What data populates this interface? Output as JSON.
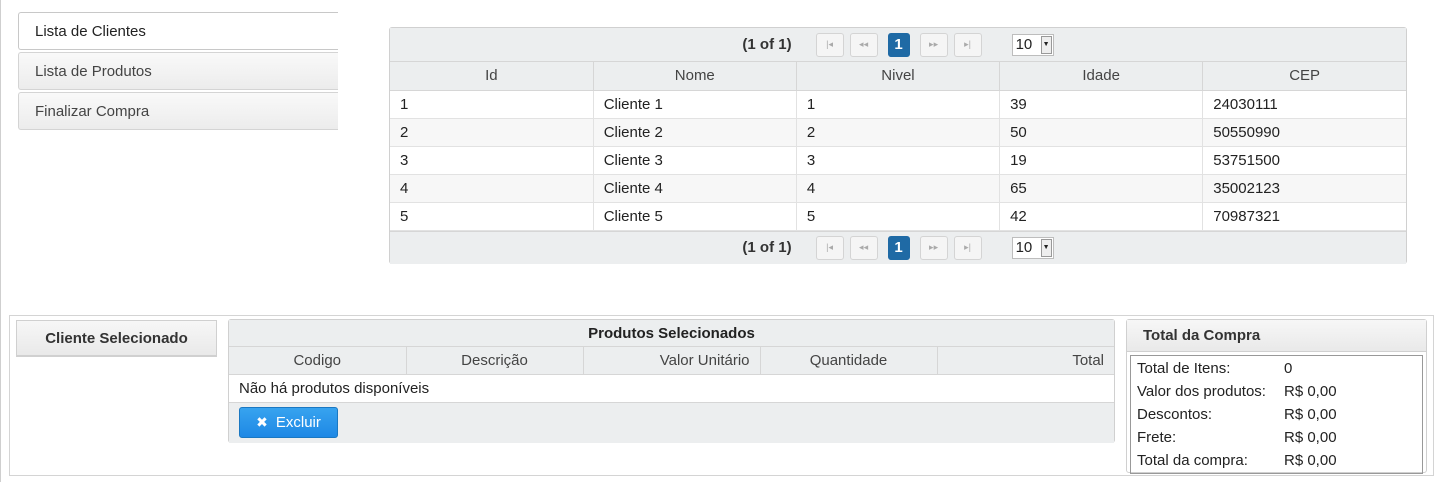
{
  "menu": {
    "items": [
      {
        "label": "Lista de Clientes"
      },
      {
        "label": "Lista de Produtos"
      },
      {
        "label": "Finalizar Compra"
      }
    ]
  },
  "clients_table": {
    "paginator": {
      "current": "(1 of 1)",
      "page": "1",
      "rows_per_page": "10"
    },
    "columns": [
      "Id",
      "Nome",
      "Nivel",
      "Idade",
      "CEP"
    ],
    "rows": [
      [
        "1",
        "Cliente 1",
        "1",
        "39",
        "24030111"
      ],
      [
        "2",
        "Cliente 2",
        "2",
        "50",
        "50550990"
      ],
      [
        "3",
        "Cliente 3",
        "3",
        "19",
        "53751500"
      ],
      [
        "4",
        "Cliente 4",
        "4",
        "65",
        "35002123"
      ],
      [
        "5",
        "Cliente 5",
        "5",
        "42",
        "70987321"
      ]
    ]
  },
  "selected_client": {
    "title": "Cliente Selecionado"
  },
  "selected_products": {
    "title": "Produtos Selecionados",
    "columns": [
      "Codigo",
      "Descrição",
      "Valor Unitário",
      "Quantidade",
      "Total"
    ],
    "empty_message": "Não há produtos disponíveis",
    "delete_label": "Excluir"
  },
  "purchase_total": {
    "title": "Total da Compra",
    "rows": [
      {
        "label": "Total de Itens:",
        "value": "0"
      },
      {
        "label": "Valor dos produtos:",
        "value": "R$ 0,00"
      },
      {
        "label": "Descontos:",
        "value": "R$ 0,00"
      },
      {
        "label": "Frete:",
        "value": "R$ 0,00"
      },
      {
        "label": "Total da compra:",
        "value": "R$ 0,00"
      }
    ]
  },
  "colors": {
    "accent": "#1f6aa5",
    "button": "#2196f3"
  }
}
